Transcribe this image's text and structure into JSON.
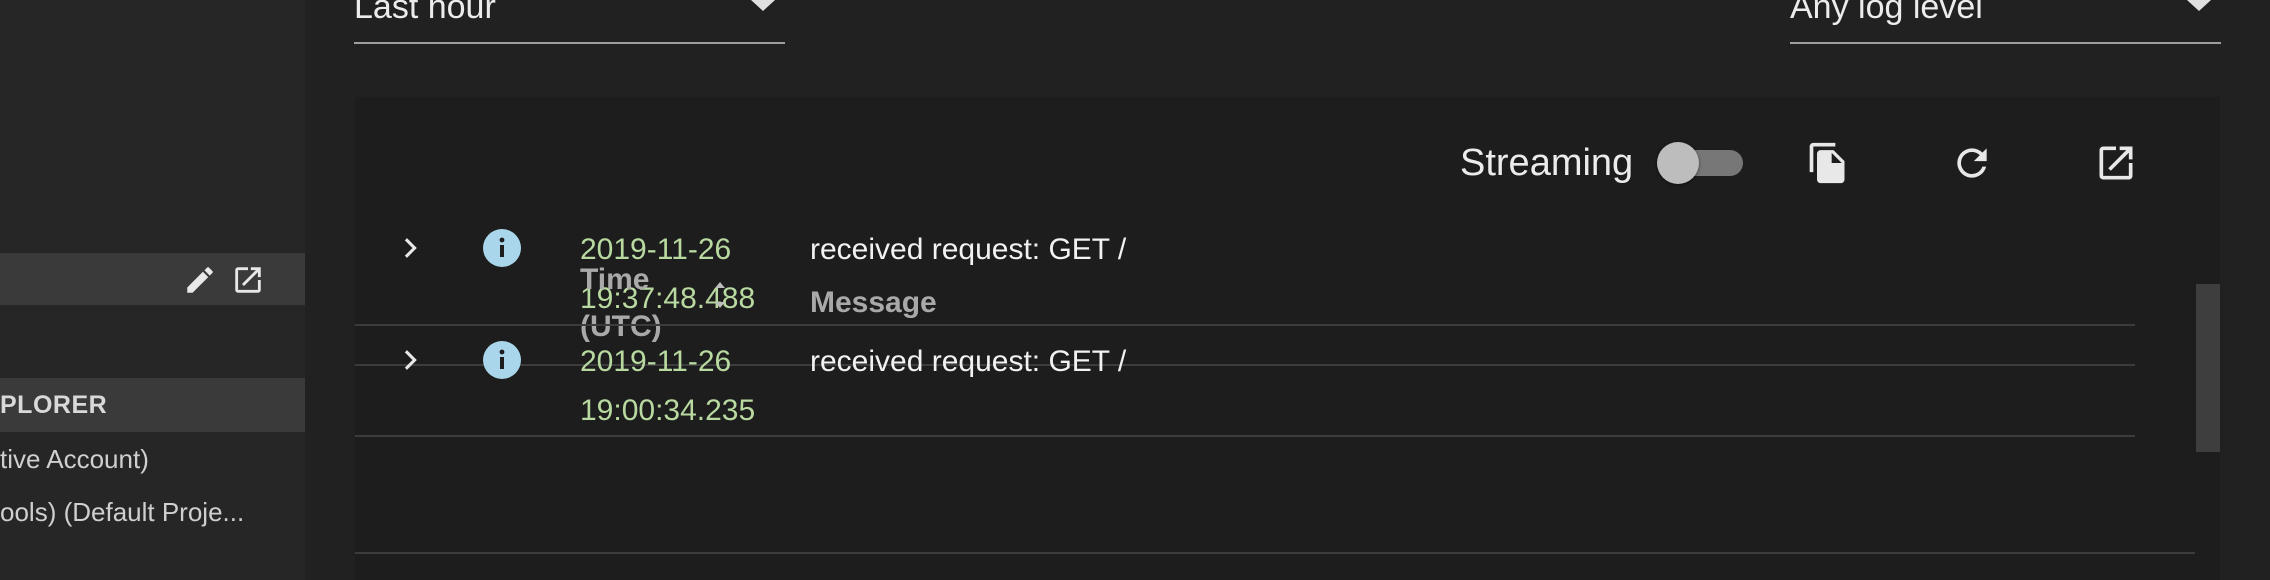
{
  "sidebar": {
    "section_title": "PLORER",
    "items": [
      "tive Account)",
      "ools) (Default Proje..."
    ]
  },
  "filters": {
    "time_range": "Last hour",
    "log_level": "Any log level"
  },
  "toolbar": {
    "streaming_label": "Streaming",
    "streaming_on": false
  },
  "table": {
    "headers": {
      "time": "Time (UTC)",
      "message": "Message"
    },
    "rows": [
      {
        "date": "2019-11-26",
        "time": "19:37:48.488",
        "message": "received request: GET /"
      },
      {
        "date": "2019-11-26",
        "time": "19:00:34.235",
        "message": "received request: GET /"
      }
    ]
  },
  "colors": {
    "background": "#212121",
    "timestamp": "#b8d9a0",
    "info_icon": "#a9d6ea"
  }
}
